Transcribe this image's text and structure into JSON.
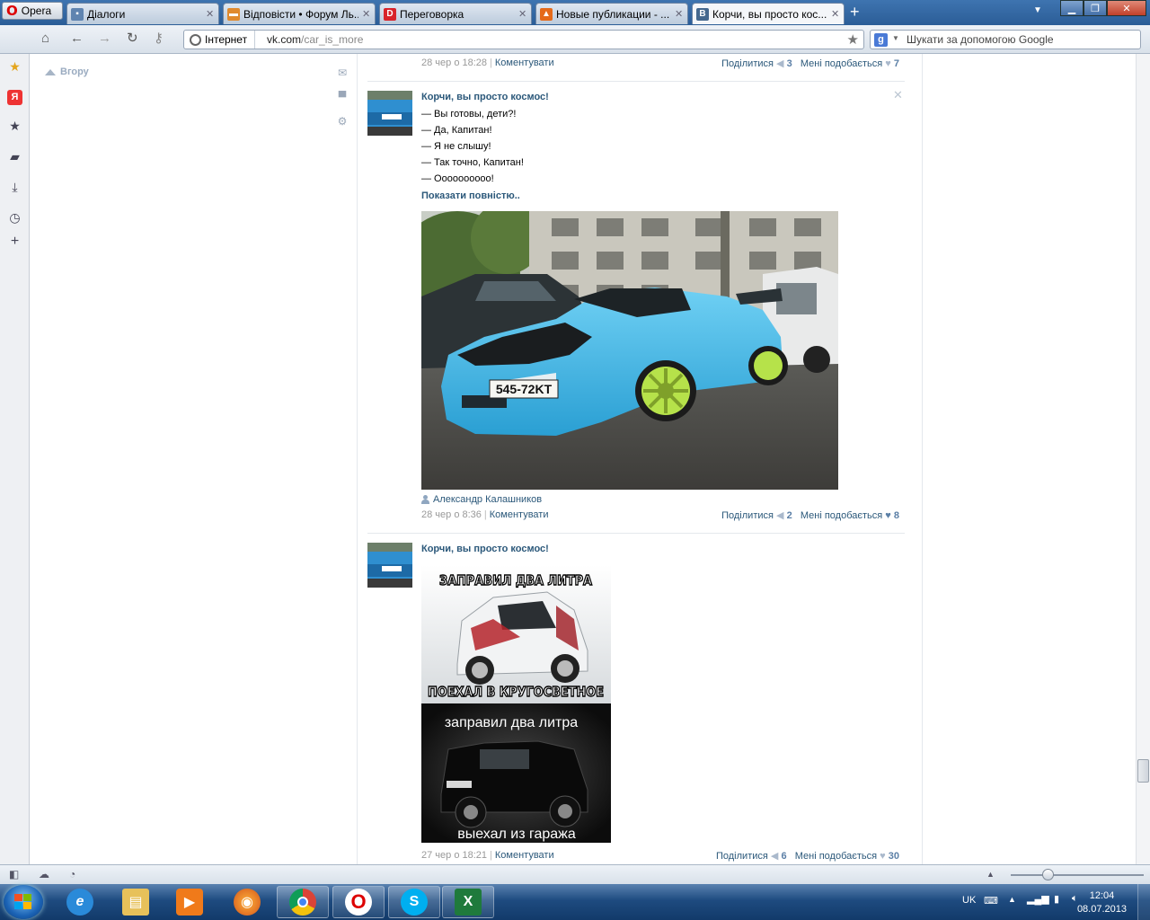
{
  "browser": {
    "menu_label": "Opera",
    "tabs": [
      {
        "title": "Діалоги",
        "icon": "vk-chat-icon",
        "color": "#5f84b0",
        "active": false
      },
      {
        "title": "Відповісти • Форум Ль...",
        "icon": "car-icon",
        "color": "#e08a2e",
        "active": false
      },
      {
        "title": "Переговорка",
        "icon": "d-logo-icon",
        "color": "#d8232a",
        "active": false
      },
      {
        "title": "Новые публикации - ...",
        "icon": "cone-icon",
        "color": "#e56a1a",
        "active": false
      },
      {
        "title": "Корчи, вы просто кос...",
        "icon": "vk-logo-icon",
        "color": "#45688e",
        "active": true
      }
    ],
    "zone_label": "Інтернет",
    "url_domain": "vk.com",
    "url_path": "/car_is_more",
    "search_placeholder": "Шукати за допомогою Google"
  },
  "page": {
    "up_link": "Вгору",
    "posts": [
      {
        "date": "28 чер о 18:28",
        "comment_label": "Коментувати",
        "share_label": "Поділитися",
        "share_count": "3",
        "like_label": "Мені подобається",
        "like_count": "7"
      },
      {
        "author": "Корчи, вы просто космос!",
        "lines": [
          "— Вы готовы, дети?!",
          "— Да, Капитан!",
          "— Я не слышу!",
          "— Так точно, Капитан!",
          "— Оооооооооо!"
        ],
        "more": "Показати повністю..",
        "plate": "545-72KT",
        "signer": "Александр Калашников",
        "date": "28 чер о 8:36",
        "comment_label": "Коментувати",
        "share_label": "Поділитися",
        "share_count": "2",
        "like_label": "Мені подобається",
        "like_count": "8"
      },
      {
        "author": "Корчи, вы просто космос!",
        "meme_top_caption": "ЗАПРАВИЛ ДВА ЛИТРА",
        "meme_mid_caption": "ПОЕХАЛ В КРУГОСВЕТНОЕ",
        "meme_bottom_caption1": "заправил два литра",
        "meme_bottom_caption2": "выехал из гаража",
        "date": "27 чер о 18:21",
        "comment_label": "Коментувати",
        "share_label": "Поділитися",
        "share_count": "6",
        "like_label": "Мені подобається",
        "like_count": "30"
      }
    ]
  },
  "taskbar": {
    "lang": "UK",
    "time": "12:04",
    "date": "08.07.2013"
  },
  "colors": {
    "vk_link": "#2b587a",
    "car_body": "#3fb4e6",
    "wheels": "#b6e24a"
  }
}
